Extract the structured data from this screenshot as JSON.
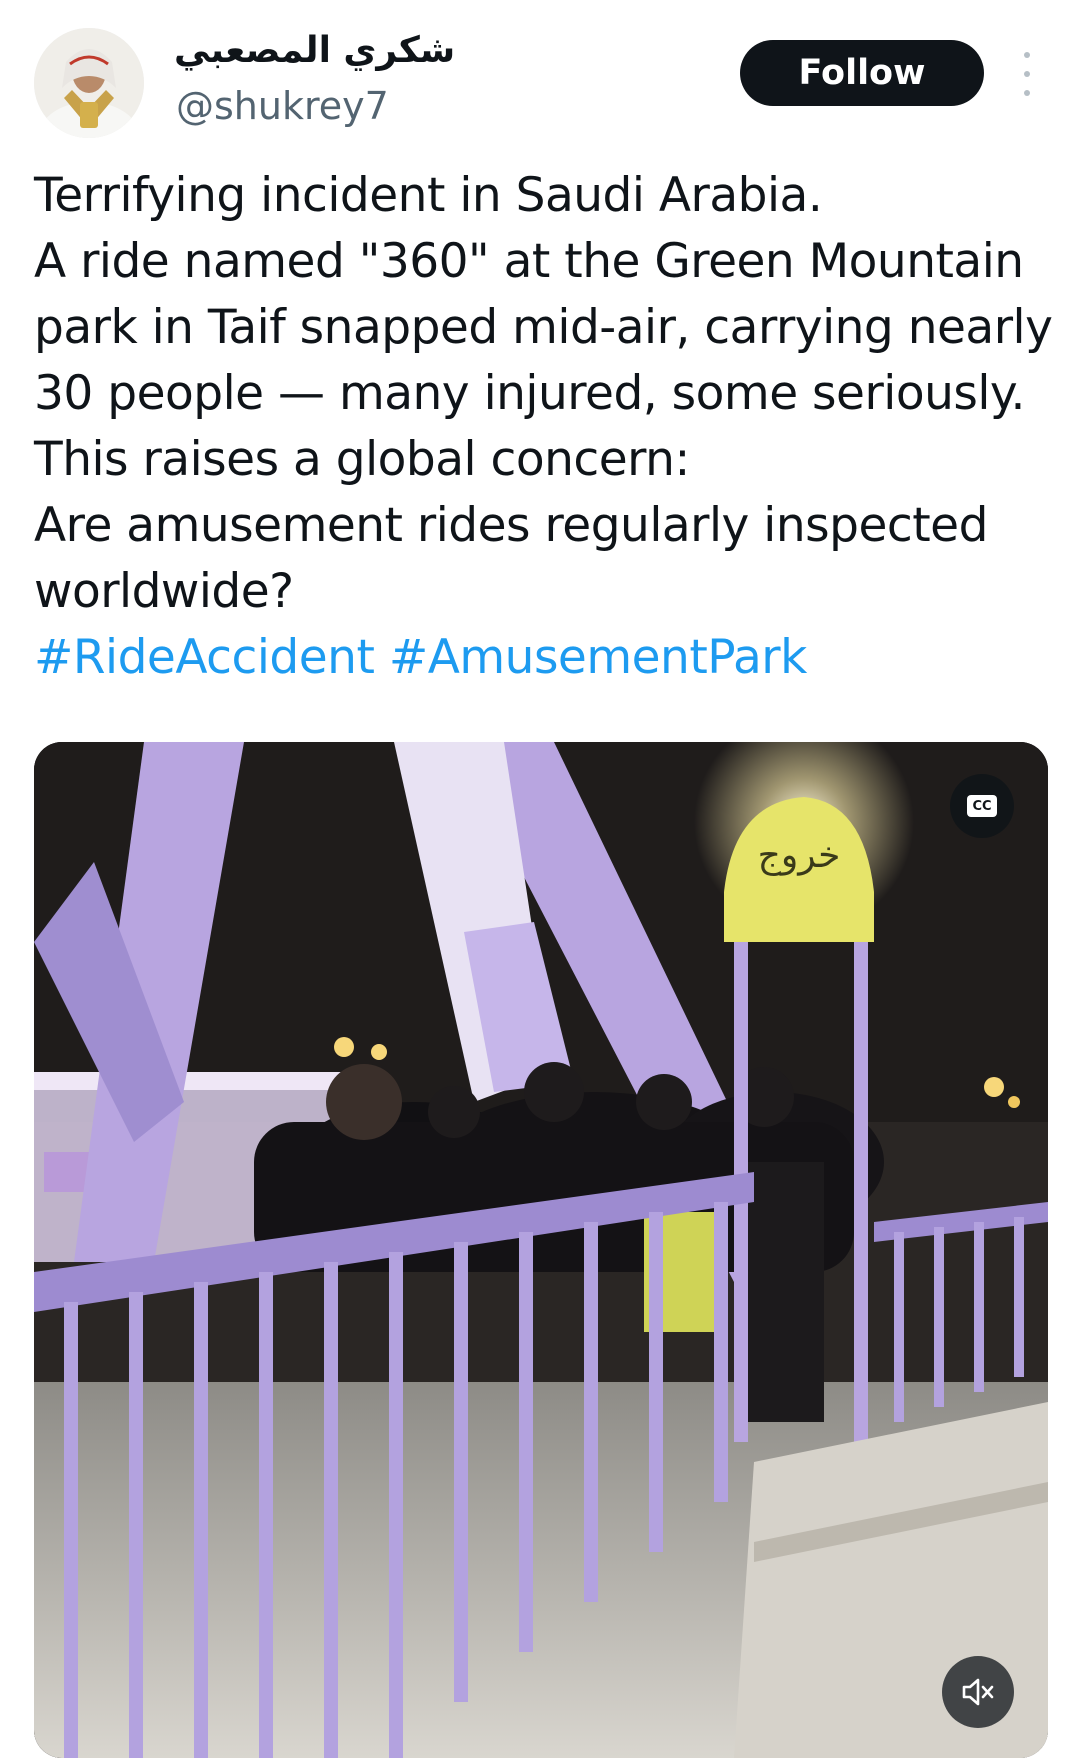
{
  "author": {
    "display_name": "شكري المصعبي",
    "handle": "@shukrey7",
    "avatar_icon": "profile-photo"
  },
  "actions": {
    "follow_label": "Follow",
    "more_icon": "more-vertical-icon"
  },
  "tweet": {
    "lines": [
      "Terrifying incident in Saudi Arabia.",
      "A ride named \"360\" at the Green Mountain",
      "park in Taif snapped mid-air, carrying nearly",
      "30 people — many injured, some seriously.",
      "This raises a global concern:",
      "Are amusement rides regularly inspected",
      "worldwide?"
    ],
    "hashtags": [
      "#RideAccident",
      "#AmusementPark"
    ]
  },
  "media": {
    "type": "video",
    "sign_text": "خروج",
    "captions_label": "CC",
    "mute_icon": "volume-muted-icon"
  },
  "colors": {
    "text_primary": "#0f1419",
    "text_secondary": "#536471",
    "link": "#1d9bf0",
    "button_bg": "#0f1419"
  }
}
